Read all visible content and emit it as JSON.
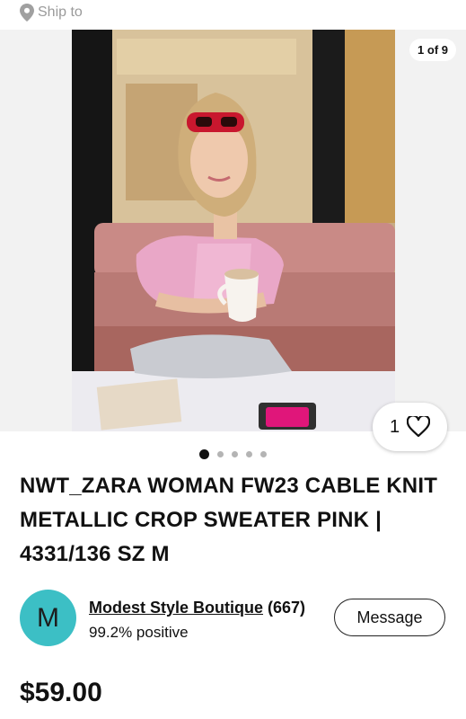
{
  "header": {
    "ship_to": "Ship to",
    "icon": "location-pin-icon"
  },
  "gallery": {
    "counter": "1 of 9",
    "watch_count": "1",
    "dots_total": 5,
    "active_dot": 1
  },
  "listing": {
    "title": "NWT_ZARA WOMAN FW23 CABLE KNIT METALLIC CROP SWEATER PINK | 4331/136 SZ M",
    "price": "$59.00"
  },
  "seller": {
    "avatar_letter": "M",
    "name": "Modest Style Boutique",
    "feedback_count": "(667)",
    "positive": "99.2% positive",
    "message_label": "Message"
  },
  "colors": {
    "avatar": "#3cbfc5",
    "text": "#111111",
    "muted": "#9a9a9a"
  }
}
